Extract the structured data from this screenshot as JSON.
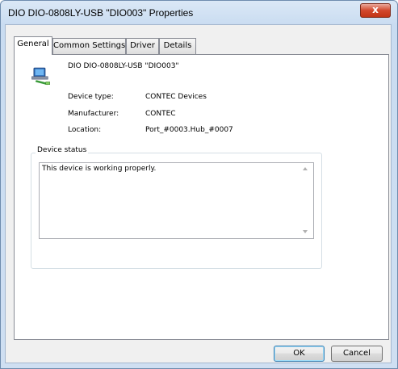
{
  "window": {
    "title": "DIO DIO-0808LY-USB \"DIO003\" Properties",
    "close_symbol": "x"
  },
  "tabs": [
    {
      "label": "General",
      "active": true
    },
    {
      "label": "Common Settings",
      "active": false
    },
    {
      "label": "Driver",
      "active": false
    },
    {
      "label": "Details",
      "active": false
    }
  ],
  "device": {
    "icon": "usb-device-icon",
    "name": "DIO DIO-0808LY-USB \"DIO003\"",
    "properties": [
      {
        "label": "Device type:",
        "value": "CONTEC Devices"
      },
      {
        "label": "Manufacturer:",
        "value": "CONTEC"
      },
      {
        "label": "Location:",
        "value": "Port_#0003.Hub_#0007"
      }
    ]
  },
  "status": {
    "group_title": "Device status",
    "text": "This device is working properly."
  },
  "buttons": {
    "ok": "OK",
    "cancel": "Cancel"
  },
  "colors": {
    "frame": "#c9dcf1",
    "close_button": "#c23516",
    "client": "#f0f0f0"
  }
}
